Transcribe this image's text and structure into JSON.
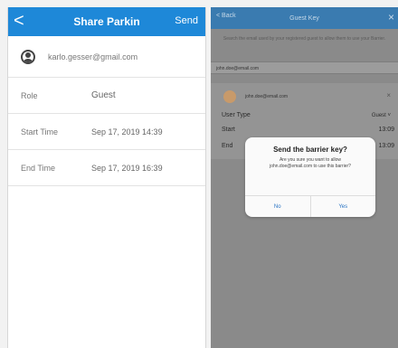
{
  "left": {
    "nav": {
      "back_icon": "<",
      "title": "Share Parkin",
      "send_label": "Send"
    },
    "user": {
      "icon": "user-circle-icon",
      "email": "karlo.gesser@gmail.com"
    },
    "rows": [
      {
        "label": "Role",
        "value": "Guest"
      },
      {
        "label": "Start Time",
        "value": "Sep 17, 2019 14:39"
      },
      {
        "label": "End Time",
        "value": "Sep 17, 2019 16:39"
      }
    ]
  },
  "right": {
    "nav": {
      "back_label": "< Back",
      "title": "Guest Key",
      "close_icon": "×"
    },
    "instructions": "Search the email used by your registered guest to allow them to use your Barrier.",
    "search_value": "john.doe@email.com",
    "card": {
      "email": "john.doe@email.com",
      "close_icon": "×",
      "user_type_label": "User Type",
      "user_type_value": "Guest ˅",
      "start_label": "Start",
      "start_value": "13:09",
      "end_label": "End",
      "end_value": "13:09"
    },
    "dialog": {
      "title": "Send the barrier key?",
      "message": "Are you sure you want to allow john.doe@email.com to use this barrier?",
      "no_label": "No",
      "yes_label": "Yes"
    }
  },
  "colors": {
    "nav_blue": "#1e88d8",
    "overlay_gray": "#8a8a8a",
    "dialog_button_blue": "#2a74c4"
  }
}
